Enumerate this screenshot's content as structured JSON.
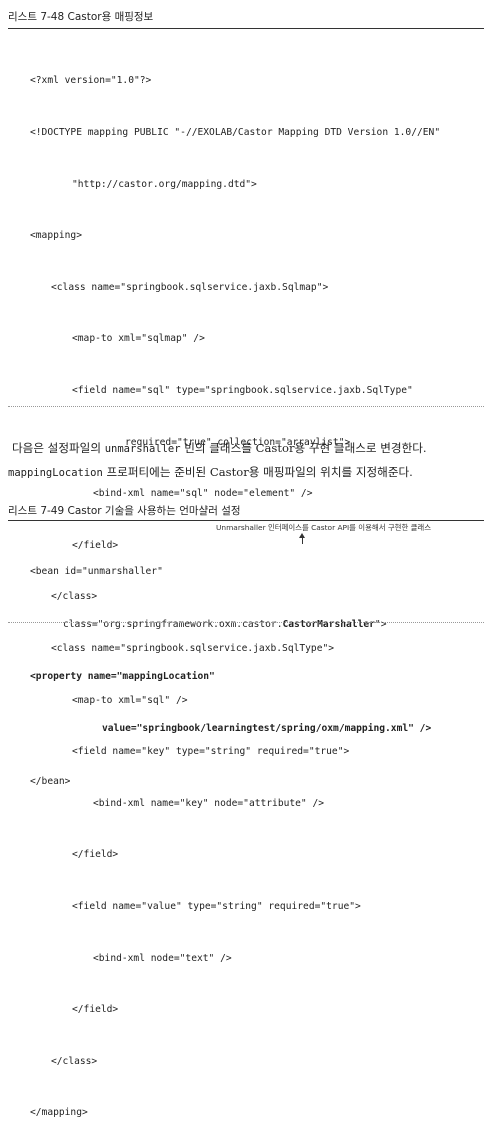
{
  "listing1": {
    "caption": "리스트 7-48 Castor용 매핑정보",
    "lines": [
      "<?xml version=\"1.0\"?>",
      "<!DOCTYPE mapping PUBLIC \"-//EXOLAB/Castor Mapping DTD Version 1.0//EN\"",
      "\"http://castor.org/mapping.dtd\">",
      "<mapping>",
      "<class name=\"springbook.sqlservice.jaxb.Sqlmap\">",
      "<map-to xml=\"sqlmap\" />",
      "<field name=\"sql\" type=\"springbook.sqlservice.jaxb.SqlType\"",
      "required=\"true\" collection=\"arraylist\">",
      "<bind-xml name=\"sql\" node=\"element\" />",
      "</field>",
      "</class>",
      "<class name=\"springbook.sqlservice.jaxb.SqlType\">",
      "<map-to xml=\"sql\" />",
      "<field name=\"key\" type=\"string\" required=\"true\">",
      "<bind-xml name=\"key\" node=\"attribute\" />",
      "</field>",
      "<field name=\"value\" type=\"string\" required=\"true\">",
      "<bind-xml node=\"text\" />",
      "</field>",
      "</class>",
      "</mapping>"
    ]
  },
  "paragraph": {
    "line1_a": "다음은 설정파일의 ",
    "line1_code": "unmarshaller",
    "line1_b": " 빈의 클래스를 Castor용 구현 클래스로 변경한다.",
    "line2_code": "mappingLocation",
    "line2_b": " 프로퍼티에는 준비된 Castor용 매핑파일의 위치를 지정해준다."
  },
  "listing2": {
    "caption": "리스트 7-49 Castor 기술을 사용하는 언마샬러 설정",
    "annotation": "Unmarshaller 인터페이스를 Castor API를 이용해서 구현한 클래스",
    "line1": "<bean id=\"unmarshaller\"",
    "line2_a": "class=\"org.springframework.oxm.castor.",
    "line2_bold": "CastorMarshaller",
    "line2_b": "\">",
    "line3": "<property name=\"mappingLocation\"",
    "line4": "value=\"springbook/learningtest/spring/oxm/mapping.xml\" />",
    "line5": "</bean>"
  }
}
